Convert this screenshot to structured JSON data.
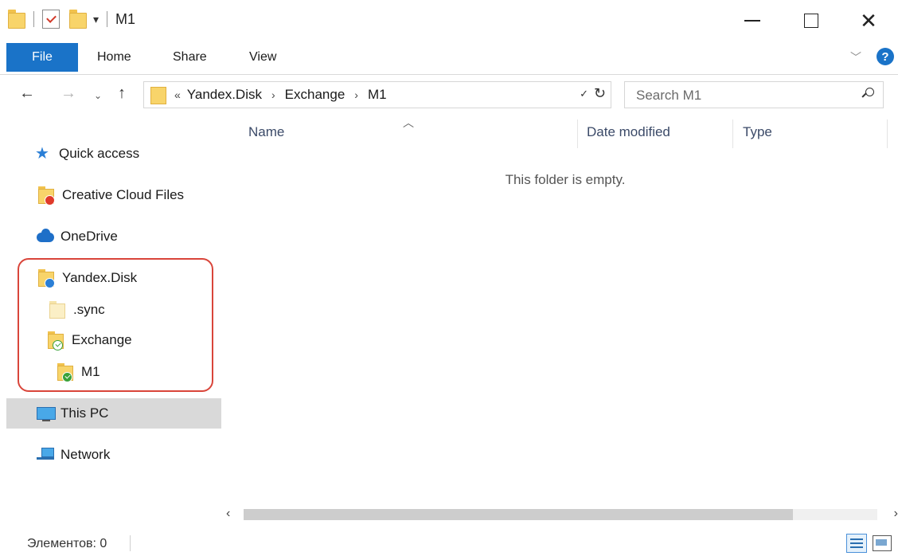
{
  "window": {
    "title": "M1",
    "qa_dropdown": "▾"
  },
  "ribbon": {
    "tabs": [
      {
        "label": "File"
      },
      {
        "label": "Home"
      },
      {
        "label": "Share"
      },
      {
        "label": "View"
      }
    ]
  },
  "address": {
    "lead": "«",
    "crumbs": [
      "Yandex.Disk",
      "Exchange",
      "M1"
    ],
    "separator": "›"
  },
  "search": {
    "placeholder": "Search M1"
  },
  "nav": {
    "items": [
      {
        "label": "Quick access",
        "icon": "quick-access-star-icon"
      },
      {
        "label": "Creative Cloud Files",
        "icon": "creative-cloud-folder-icon"
      },
      {
        "label": "OneDrive",
        "icon": "onedrive-cloud-icon"
      },
      {
        "label": "Yandex.Disk",
        "icon": "yandex-disk-folder-icon"
      },
      {
        "label": ".sync",
        "icon": "folder-icon"
      },
      {
        "label": "Exchange",
        "icon": "synced-folder-icon"
      },
      {
        "label": "M1",
        "icon": "synced-folder-icon"
      },
      {
        "label": "This PC",
        "icon": "computer-icon"
      },
      {
        "label": "Network",
        "icon": "network-icon"
      }
    ],
    "selected": "This PC",
    "highlight_color": "#d9453a"
  },
  "columns": [
    {
      "label": "Name"
    },
    {
      "label": "Date modified"
    },
    {
      "label": "Type"
    }
  ],
  "content": {
    "empty_message": "This folder is empty."
  },
  "status": {
    "items_text": "Элементов: 0"
  },
  "colors": {
    "accent": "#1a73c8",
    "folder": "#f8d46a",
    "selection": "#d9d9d9"
  }
}
